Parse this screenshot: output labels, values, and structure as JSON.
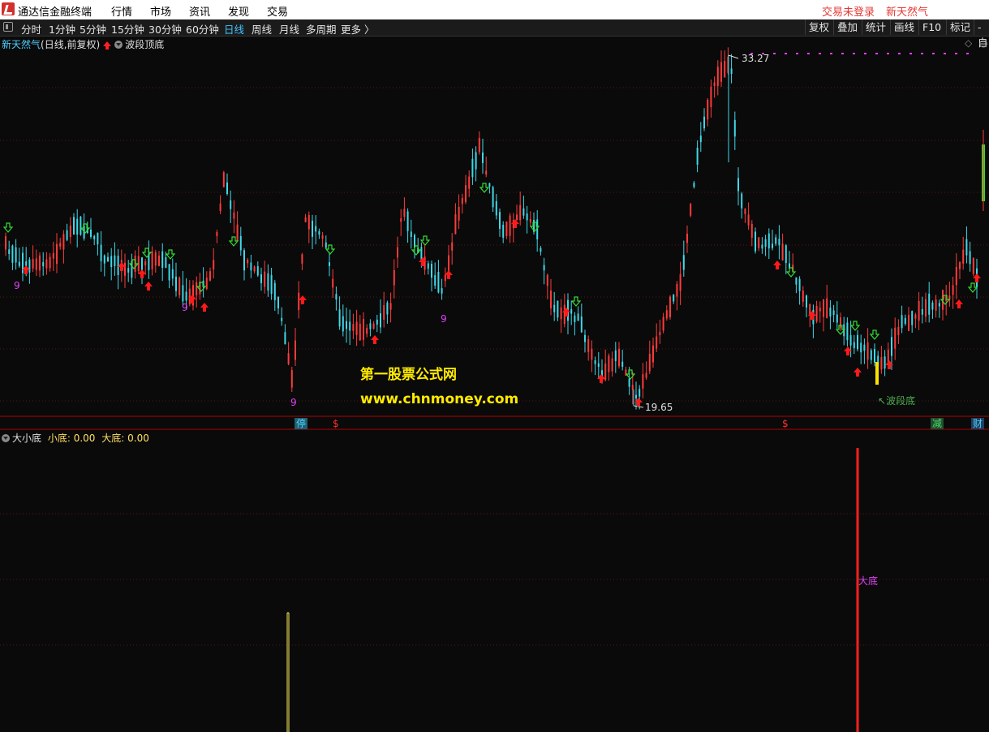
{
  "titlebar": {
    "app_title": "通达信金融终端",
    "menu": [
      "行情",
      "市场",
      "资讯",
      "发现",
      "交易"
    ],
    "trade_status": "交易未登录",
    "stock_name": "新天然气"
  },
  "toolbar": {
    "periods": [
      "分时",
      "1分钟",
      "5分钟",
      "15分钟",
      "30分钟",
      "60分钟",
      "日线",
      "周线",
      "月线",
      "多周期",
      "更多 〉"
    ],
    "active_period": "日线",
    "right_buttons": [
      "复权",
      "叠加",
      "统计",
      "画线",
      "F10",
      "标记",
      "-自"
    ]
  },
  "main_panel": {
    "stock": "新天然气",
    "period_info": "(日线,前复权)",
    "indicator": "波段顶底",
    "high_label": "33.27",
    "low_label": "19.65",
    "bottom_label": "波段底",
    "digit_label": "9"
  },
  "axis_tags": {
    "ting": "停",
    "s1": "$",
    "s2": "$",
    "jian": "减",
    "cai": "财"
  },
  "watermark": {
    "line1": "第一股票公式网",
    "line2": "www.chnmoney.com"
  },
  "sub_panel": {
    "indicator": "大小底",
    "small_label": "小底:",
    "small_value": "0.00",
    "big_label": "大底:",
    "big_value": "0.00",
    "big_bottom_tag": "大底"
  },
  "colors": {
    "up": "#ff3b3b",
    "down": "#3fd8e8",
    "buy_arrow": "#ff1a1a",
    "sell_arrow": "#33dd33",
    "grid": "#5a1515",
    "separator": "#b00000"
  }
}
